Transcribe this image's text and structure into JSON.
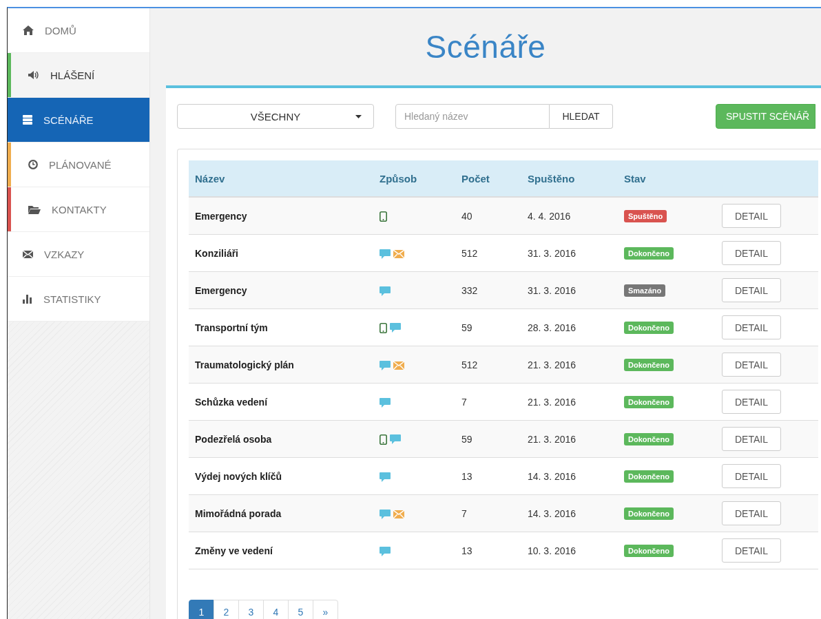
{
  "sidebar": {
    "items": [
      {
        "label": "DOMŮ",
        "selected": false
      },
      {
        "label": "HLÁŠENÍ",
        "selected": false,
        "color": "#5cb85c"
      },
      {
        "label": "SCÉNÁŘE",
        "selected": true
      },
      {
        "label": "PLÁNOVANÉ",
        "selected": false,
        "color": "#f0ad4e"
      },
      {
        "label": "KONTAKTY",
        "selected": false,
        "color": "#d9534f"
      },
      {
        "label": "VZKAZY",
        "selected": false
      },
      {
        "label": "STATISTIKY",
        "selected": false
      }
    ]
  },
  "page_title": "Scénáře",
  "toolbar": {
    "filter": "VŠECHNY",
    "search": {
      "placeholder": "Hledaný název"
    },
    "search_button": "HLEDAT",
    "run_button": "SPUSTIT SCÉNÁŘ"
  },
  "table": {
    "columns": [
      "Název",
      "Způsob",
      "Počet",
      "Spuštěno",
      "Stav"
    ],
    "rows": [
      {
        "name": "Emergency",
        "methods": [
          {
            "kind": "phone"
          }
        ],
        "count": "40",
        "started": "4. 4. 2016",
        "status": {
          "label": "Spuštěno",
          "color": "#d9534f"
        },
        "action": "DETAIL"
      },
      {
        "name": "Konziliáři",
        "methods": [
          {
            "kind": "chat"
          },
          {
            "kind": "mail"
          }
        ],
        "count": "512",
        "started": "31. 3. 2016",
        "status": {
          "label": "Dokončeno",
          "color": "#5cb85c"
        },
        "action": "DETAIL"
      },
      {
        "name": "Emergency",
        "methods": [
          {
            "kind": "chat"
          }
        ],
        "count": "332",
        "started": "31. 3. 2016",
        "status": {
          "label": "Smazáno",
          "color": "#777777"
        },
        "action": "DETAIL"
      },
      {
        "name": "Transportní tým",
        "methods": [
          {
            "kind": "phone"
          },
          {
            "kind": "chat"
          }
        ],
        "count": "59",
        "started": "28. 3. 2016",
        "status": {
          "label": "Dokončeno",
          "color": "#5cb85c"
        },
        "action": "DETAIL"
      },
      {
        "name": "Traumatologický plán",
        "methods": [
          {
            "kind": "chat"
          },
          {
            "kind": "mail"
          }
        ],
        "count": "512",
        "started": "21. 3. 2016",
        "status": {
          "label": "Dokončeno",
          "color": "#5cb85c"
        },
        "action": "DETAIL"
      },
      {
        "name": "Schůzka vedení",
        "methods": [
          {
            "kind": "chat"
          }
        ],
        "count": "7",
        "started": "21. 3. 2016",
        "status": {
          "label": "Dokončeno",
          "color": "#5cb85c"
        },
        "action": "DETAIL"
      },
      {
        "name": "Podezřelá osoba",
        "methods": [
          {
            "kind": "phone"
          },
          {
            "kind": "chat"
          }
        ],
        "count": "59",
        "started": "21. 3. 2016",
        "status": {
          "label": "Dokončeno",
          "color": "#5cb85c"
        },
        "action": "DETAIL"
      },
      {
        "name": "Výdej nových klíčů",
        "methods": [
          {
            "kind": "chat"
          }
        ],
        "count": "13",
        "started": "14. 3. 2016",
        "status": {
          "label": "Dokončeno",
          "color": "#5cb85c"
        },
        "action": "DETAIL"
      },
      {
        "name": "Mimořádná porada",
        "methods": [
          {
            "kind": "chat"
          },
          {
            "kind": "mail"
          }
        ],
        "count": "7",
        "started": "14. 3. 2016",
        "status": {
          "label": "Dokončeno",
          "color": "#5cb85c"
        },
        "action": "DETAIL"
      },
      {
        "name": "Změny ve vedení",
        "methods": [
          {
            "kind": "chat"
          }
        ],
        "count": "13",
        "started": "10. 3. 2016",
        "status": {
          "label": "Dokončeno",
          "color": "#5cb85c"
        },
        "action": "DETAIL"
      }
    ]
  },
  "pagination": [
    {
      "label": "1",
      "selected": true
    },
    {
      "label": "2",
      "selected": false
    },
    {
      "label": "3",
      "selected": false
    },
    {
      "label": "4",
      "selected": false
    },
    {
      "label": "5",
      "selected": false
    },
    {
      "label": "»",
      "selected": false
    }
  ]
}
